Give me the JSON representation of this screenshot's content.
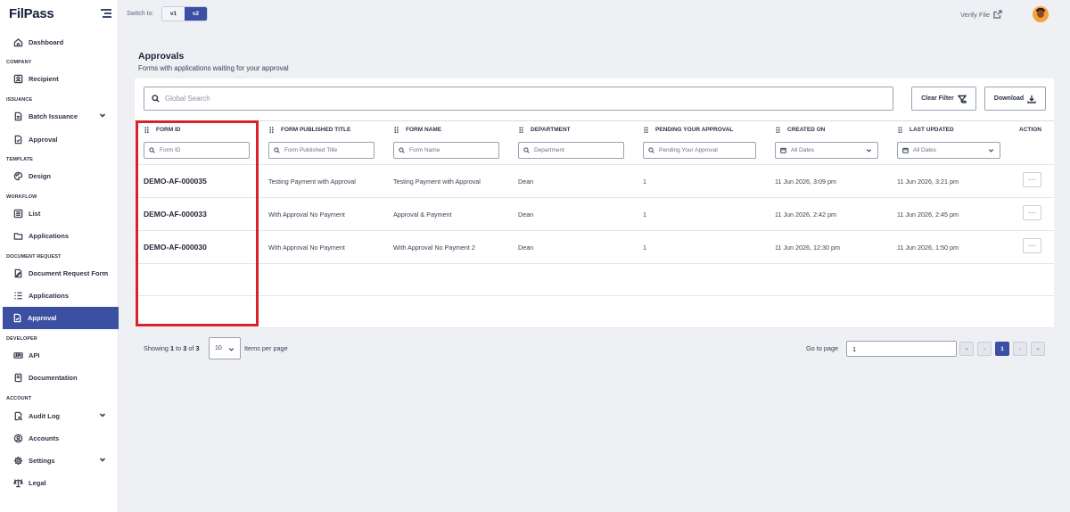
{
  "app": {
    "logo_text": "FilPass"
  },
  "topbar": {
    "switch_label": "Switch to:",
    "versions": [
      "v1",
      "v2"
    ],
    "active_version": "v2",
    "verify_label": "Verify File"
  },
  "sidebar": {
    "dashboard": "Dashboard",
    "sections": {
      "company": "COMPANY",
      "issuance": "ISSUANCE",
      "template": "TEMPLATE",
      "workflow": "WORKFLOW",
      "document_request": "DOCUMENT REQUEST",
      "developer": "DEVELOPER",
      "account": "ACCOUNT"
    },
    "items": {
      "recipient": "Recipient",
      "batch_issuance": "Batch Issuance",
      "approval_issuance": "Approval",
      "design": "Design",
      "list": "List",
      "applications_workflow": "Applications",
      "document_request_form": "Document Request Form",
      "applications_docreq": "Applications",
      "approval_docreq": "Approval",
      "api": "API",
      "documentation": "Documentation",
      "audit_log": "Audit Log",
      "accounts": "Accounts",
      "settings": "Settings",
      "legal": "Legal"
    },
    "active_item": "approval_docreq"
  },
  "page": {
    "title": "Approvals",
    "subtitle": "Forms with applications waiting for your approval"
  },
  "toolbar": {
    "search_placeholder": "Global Search",
    "clear_filter_label": "Clear Filter",
    "download_label": "Download"
  },
  "table": {
    "columns": {
      "form_id": "FORM ID",
      "form_published_title": "FORM PUBLISHED TITLE",
      "form_name": "FORM NAME",
      "department": "DEPARTMENT",
      "pending": "PENDING YOUR APPROVAL",
      "created_on": "CREATED ON",
      "last_updated": "LAST UPDATED",
      "action": "ACTION"
    },
    "filters": {
      "form_id": "Form ID",
      "form_published_title": "Form Published Title",
      "form_name": "Form Name",
      "department": "Department",
      "pending": "Pending Your Approval",
      "created_on": "All Dates",
      "last_updated": "All Dates"
    },
    "rows": [
      {
        "form_id": "DEMO-AF-000035",
        "form_published_title": "Testing Payment with Approval",
        "form_name": "Testing Payment with Approval",
        "department": "Dean",
        "pending": "1",
        "created_on": "11 Jun 2026, 3:09 pm",
        "last_updated": "11 Jun 2026, 3:21 pm",
        "action": "···"
      },
      {
        "form_id": "DEMO-AF-000033",
        "form_published_title": "With Approval No Payment",
        "form_name": "Approval & Payment",
        "department": "Dean",
        "pending": "1",
        "created_on": "11 Jun 2026, 2:42 pm",
        "last_updated": "11 Jun 2026, 2:45 pm",
        "action": "···"
      },
      {
        "form_id": "DEMO-AF-000030",
        "form_published_title": "With Approval No Payment",
        "form_name": "With Approval No Payment 2",
        "department": "Dean",
        "pending": "1",
        "created_on": "11 Jun 2026, 12:30 pm",
        "last_updated": "11 Jun 2026, 1:50 pm",
        "action": "···"
      }
    ]
  },
  "pagination": {
    "showing_prefix": "Showing",
    "from": "1",
    "to_word": "to",
    "to": "3",
    "of_word": "of",
    "total": "3",
    "per_page": "10",
    "items_label": "Items per page",
    "goto_label": "Go to page",
    "goto_value": "1",
    "first": "«",
    "prev": "‹",
    "current_page": "1",
    "next": "›",
    "last": "»"
  },
  "colors": {
    "accent": "#3b4fa3",
    "highlight": "#d8232a",
    "background": "#eef0f4"
  }
}
